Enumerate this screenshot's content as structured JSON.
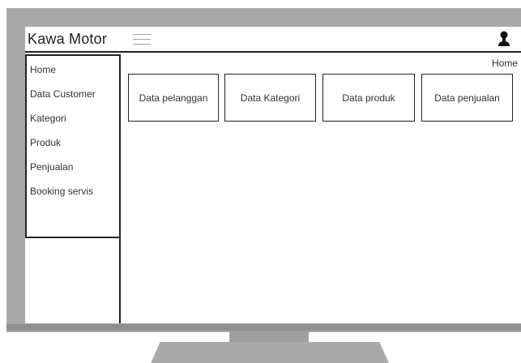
{
  "header": {
    "title": "Kawa Motor",
    "menu_icon": "hamburger-menu-icon",
    "user_icon": "user-icon"
  },
  "breadcrumb": "Home",
  "sidebar": {
    "items": [
      {
        "label": "Home"
      },
      {
        "label": "Data Customer"
      },
      {
        "label": "Kategori"
      },
      {
        "label": "Produk"
      },
      {
        "label": "Penjualan"
      },
      {
        "label": "Booking servis"
      }
    ]
  },
  "cards": [
    {
      "label": "Data pelanggan"
    },
    {
      "label": "Data Kategori"
    },
    {
      "label": "Data produk"
    },
    {
      "label": "Data penjualan"
    }
  ],
  "colors": {
    "monitor": "#a9a9a9",
    "border": "#222222",
    "text": "#333333"
  }
}
